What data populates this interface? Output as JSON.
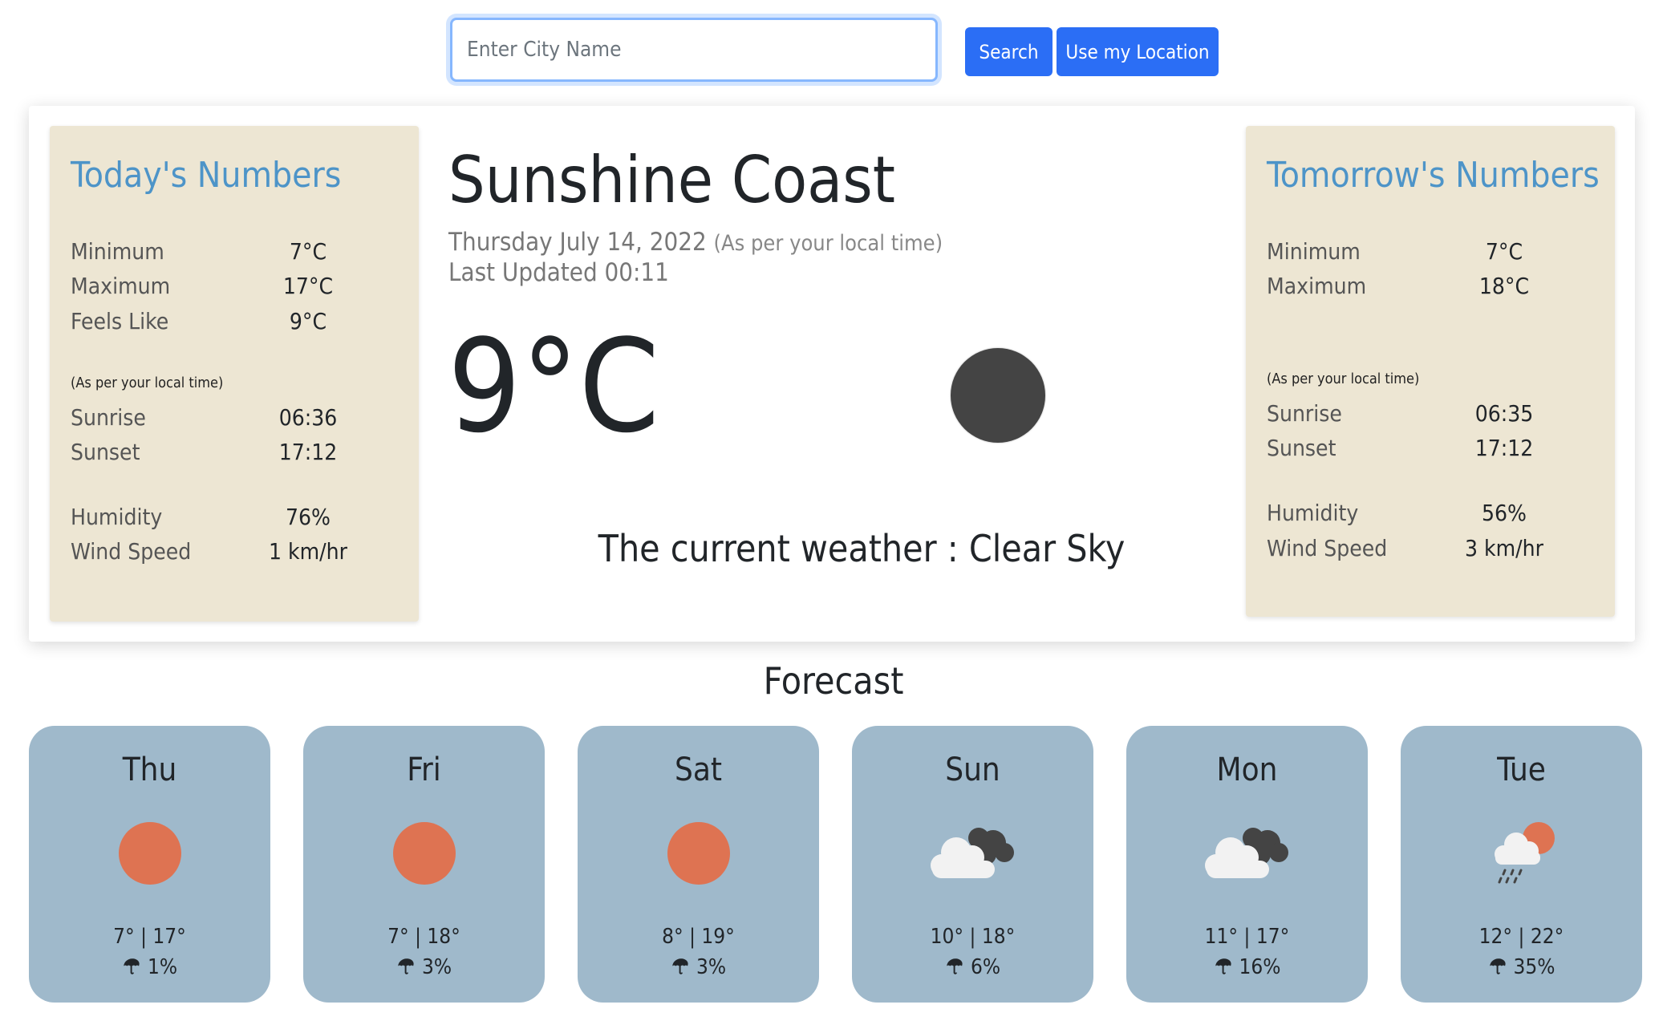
{
  "search": {
    "placeholder": "Enter City Name",
    "search_label": "Search",
    "location_label": "Use my Location"
  },
  "today": {
    "title": "Today's Numbers",
    "minimum_label": "Minimum",
    "minimum": "7°C",
    "maximum_label": "Maximum",
    "maximum": "17°C",
    "feels_label": "Feels Like",
    "feels": "9°C",
    "note": "(As per your local time)",
    "sunrise_label": "Sunrise",
    "sunrise": "06:36",
    "sunset_label": "Sunset",
    "sunset": "17:12",
    "humidity_label": "Humidity",
    "humidity": "76%",
    "wind_label": "Wind Speed",
    "wind": "1 km/hr"
  },
  "current": {
    "city": "Sunshine Coast",
    "date": "Thursday July 14, 2022",
    "date_note": "(As per your local time)",
    "updated": "Last Updated 00:11",
    "temp": "9°C",
    "icon": "moon-icon",
    "description": "The current weather : Clear Sky"
  },
  "tomorrow": {
    "title": "Tomorrow's Numbers",
    "minimum_label": "Minimum",
    "minimum": "7°C",
    "maximum_label": "Maximum",
    "maximum": "18°C",
    "note": "(As per your local time)",
    "sunrise_label": "Sunrise",
    "sunrise": "06:35",
    "sunset_label": "Sunset",
    "sunset": "17:12",
    "humidity_label": "Humidity",
    "humidity": "56%",
    "wind_label": "Wind Speed",
    "wind": "3 km/hr"
  },
  "forecast": {
    "title": "Forecast",
    "days": [
      {
        "day": "Thu",
        "temps": "7° | 17°",
        "rain": "1%",
        "icon": "sun-icon"
      },
      {
        "day": "Fri",
        "temps": "7° | 18°",
        "rain": "3%",
        "icon": "sun-icon"
      },
      {
        "day": "Sat",
        "temps": "8° | 19°",
        "rain": "3%",
        "icon": "sun-icon"
      },
      {
        "day": "Sun",
        "temps": "10° | 18°",
        "rain": "6%",
        "icon": "clouds-icon"
      },
      {
        "day": "Mon",
        "temps": "11° | 17°",
        "rain": "16%",
        "icon": "clouds-icon"
      },
      {
        "day": "Tue",
        "temps": "12° | 22°",
        "rain": "35%",
        "icon": "rain-sun-icon"
      }
    ]
  },
  "colors": {
    "accent": "#2b6ef5",
    "panel_bg": "#ede6d3",
    "panel_title": "#4d94c8",
    "forecast_card": "#9fb9cb",
    "sun": "#de7352",
    "moon": "#444444"
  }
}
